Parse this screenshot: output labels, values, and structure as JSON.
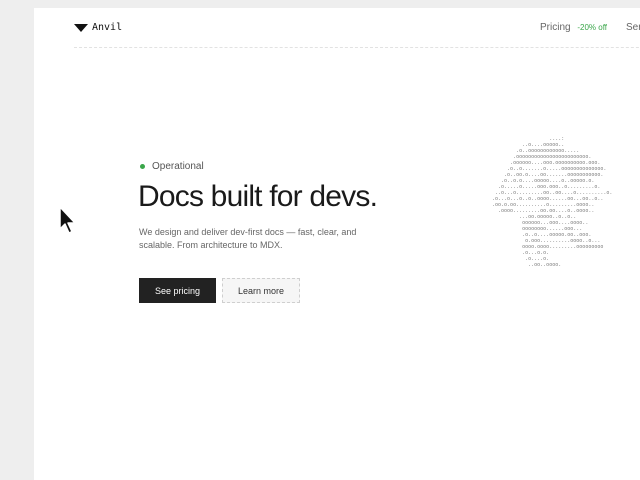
{
  "brand": {
    "name": "Anvil"
  },
  "nav": {
    "pricing_label": "Pricing",
    "pricing_badge": "-20% off",
    "services_label": "Ser"
  },
  "hero": {
    "status_text": "Operational",
    "title": "Docs built for devs.",
    "description": "We design and deliver dev-first docs — fast, clear, and scalable. From architecture to MDX.",
    "primary_cta": "See pricing",
    "secondary_cta": "Learn more"
  },
  "ascii_art": "                   ....:\n          ..o....ooooo..\n        .o..oooooooooooo.....\n       .oooooooooooooooooooooooo.\n      .oooooo....ooo.oooooooooo.ooo.\n     .o..o.......o.....oooooooooooooo.\n    .o..oo.o....oo.......ooooooooooo.\n   .o..o.o....ooooo....o..ooooo.o.\n  .o.....o.....ooo.ooo..o.........o.\n ..o...o.........oo..oo....o..........o.\n.o...o...o..o..oooo......oo...oo..o..\n.oo.o.oo..........o.........oooo..\n  .oooo.........oo.oo....o..oooo..\n         ...oo.ooooo..o..o..\n          oooooo...ooo....oooo..\n          oooooooo......ooo...\n          .o..o....ooooo.oo..ooo.\n           o.ooo..........oooo..o...\n          oooo.oooo.........ooooooooo\n          .o...o.o.\n           .o....o.\n            ..oo..oooo.",
  "colors": {
    "accent_green": "#3aa64a",
    "primary_button": "#222222",
    "page_background": "#ffffff",
    "outer_background": "#eeeeee"
  }
}
